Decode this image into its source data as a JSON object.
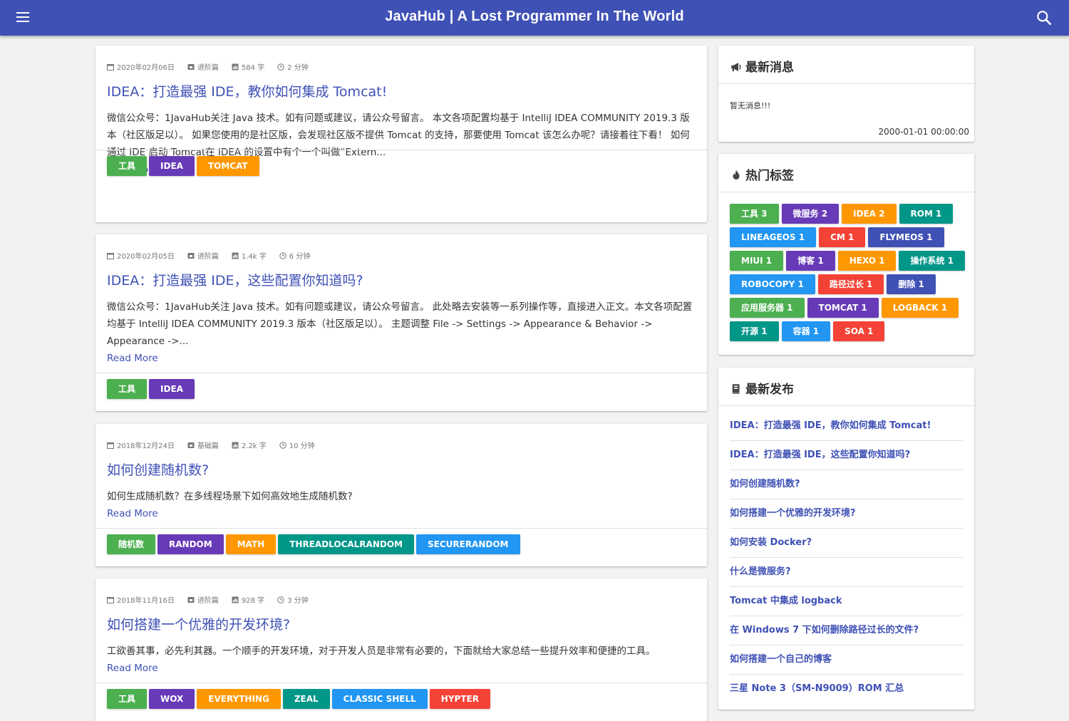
{
  "header": {
    "title": "JavaHub | A Lost Programmer In The World",
    "menu_icon": "hamburger-menu-icon",
    "search_icon": "search-icon"
  },
  "colors": {
    "primary": "#3f51b5",
    "green": "#4caf50",
    "purple": "#673ab7",
    "orange": "#ff9800",
    "teal": "#009688",
    "blue": "#2196f3",
    "red": "#f44336",
    "indigo": "#3f51b5"
  },
  "posts": [
    {
      "date": "2020年02月06日",
      "category": "进阶篇",
      "words": "584 字",
      "read_time": "2 分钟",
      "title": "IDEA：打造最强 IDE，教你如何集成 Tomcat!",
      "excerpt": "微信公众号：1JavaHub关注 Java 技术。如有问题或建议，请公众号留言。 本文各项配置均基于 IntelliJ IDEA COMMUNITY 2019.3 版本（社区版足以）。 如果您使用的是社区版，会发现社区版不提供 Tomcat 的支持，那要使用 Tomcat 该怎么办呢？请接着往下看！ 如何通过 IDE 启动 Tomcat在 IDEA 的设置中有个一个叫做“Extern...",
      "read_more": "Read More",
      "tags": [
        {
          "label": "工具",
          "color": "#4caf50"
        },
        {
          "label": "IDEA",
          "color": "#673ab7"
        },
        {
          "label": "TOMCAT",
          "color": "#ff9800"
        }
      ]
    },
    {
      "date": "2020年02月05日",
      "category": "进阶篇",
      "words": "1.4k 字",
      "read_time": "6 分钟",
      "title": "IDEA：打造最强 IDE，这些配置你知道吗?",
      "excerpt": "微信公众号：1JavaHub关注 Java 技术。如有问题或建议，请公众号留言。 此处略去安装等一系列操作等，直接进入正文。本文各项配置均基于 IntelliJ IDEA COMMUNITY 2019.3 版本（社区版足以）。 主题调整 File -> Settings -> Appearance & Behavior -> Appearance ->...",
      "read_more": "Read More",
      "tags": [
        {
          "label": "工具",
          "color": "#4caf50"
        },
        {
          "label": "IDEA",
          "color": "#673ab7"
        }
      ]
    },
    {
      "date": "2018年12月24日",
      "category": "基础篇",
      "words": "2.2k 字",
      "read_time": "10 分钟",
      "title": "如何创建随机数?",
      "excerpt": "如何生成随机数？在多线程场景下如何高效地生成随机数?",
      "read_more": "Read More",
      "tags": [
        {
          "label": "随机数",
          "color": "#4caf50"
        },
        {
          "label": "RANDOM",
          "color": "#673ab7"
        },
        {
          "label": "MATH",
          "color": "#ff9800"
        },
        {
          "label": "THREADLOCALRANDOM",
          "color": "#009688"
        },
        {
          "label": "SECURERANDOM",
          "color": "#2196f3"
        }
      ]
    },
    {
      "date": "2018年11月16日",
      "category": "进阶篇",
      "words": "928 字",
      "read_time": "3 分钟",
      "title": "如何搭建一个优雅的开发环境?",
      "excerpt": "工欲善其事，必先利其器。一个顺手的开发环境，对于开发人员是非常有必要的，下面就给大家总结一些提升效率和便捷的工具。",
      "read_more": "Read More",
      "tags": [
        {
          "label": "工具",
          "color": "#4caf50"
        },
        {
          "label": "WOX",
          "color": "#673ab7"
        },
        {
          "label": "EVERYTHING",
          "color": "#ff9800"
        },
        {
          "label": "ZEAL",
          "color": "#009688"
        },
        {
          "label": "CLASSIC SHELL",
          "color": "#2196f3"
        },
        {
          "label": "HYPTER",
          "color": "#f44336"
        }
      ]
    }
  ],
  "sidebar": {
    "news": {
      "title": "最新消息",
      "icon": "megaphone-icon",
      "text": "暂无消息!!!",
      "date": "2000-01-01 00:00:00"
    },
    "hot_tags": {
      "title": "热门标签",
      "icon": "fire-icon",
      "rows": [
        [
          {
            "label": "工具 3",
            "color": "#4caf50"
          },
          {
            "label": "微服务 2",
            "color": "#673ab7"
          },
          {
            "label": "IDEA 2",
            "color": "#ff9800"
          },
          {
            "label": "ROM 1",
            "color": "#009688"
          }
        ],
        [
          {
            "label": "LINEAGEOS 1",
            "color": "#2196f3"
          },
          {
            "label": "CM 1",
            "color": "#f44336"
          },
          {
            "label": "FLYMEOS 1",
            "color": "#3f51b5"
          }
        ],
        [
          {
            "label": "MIUI 1",
            "color": "#4caf50"
          },
          {
            "label": "博客 1",
            "color": "#673ab7"
          },
          {
            "label": "HEXO 1",
            "color": "#ff9800"
          },
          {
            "label": "操作系统 1",
            "color": "#009688"
          }
        ],
        [
          {
            "label": "ROBOCOPY 1",
            "color": "#2196f3"
          },
          {
            "label": "路径过长 1",
            "color": "#f44336"
          },
          {
            "label": "删除 1",
            "color": "#3f51b5"
          }
        ],
        [
          {
            "label": "应用服务器 1",
            "color": "#4caf50"
          },
          {
            "label": "TOMCAT 1",
            "color": "#673ab7"
          },
          {
            "label": "LOGBACK 1",
            "color": "#ff9800"
          }
        ],
        [
          {
            "label": "开源 1",
            "color": "#009688"
          },
          {
            "label": "容器 1",
            "color": "#2196f3"
          },
          {
            "label": "SOA 1",
            "color": "#f44336"
          }
        ]
      ]
    },
    "recent": {
      "title": "最新发布",
      "icon": "book-icon",
      "items": [
        "IDEA：打造最强 IDE，教你如何集成 Tomcat!",
        "IDEA：打造最强 IDE，这些配置你知道吗?",
        "如何创建随机数?",
        "如何搭建一个优雅的开发环境?",
        "如何安装 Docker?",
        "什么是微服务?",
        "Tomcat 中集成 logback",
        "在 Windows 7 下如何删除路径过长的文件?",
        "如何搭建一个自己的博客",
        "三星 Note 3（SM-N9009）ROM 汇总"
      ]
    }
  }
}
